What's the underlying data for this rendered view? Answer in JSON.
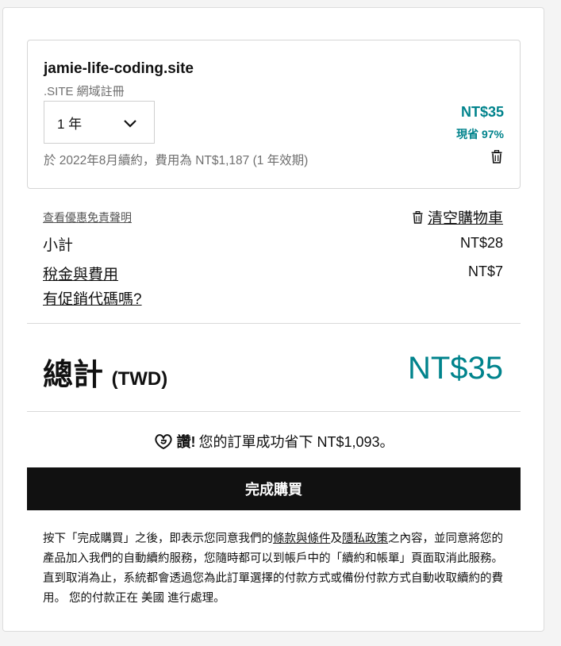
{
  "cart_item": {
    "domain": "jamie-life-coding.site",
    "tld_label": ".SITE 網域註冊",
    "term_selected": "1 年",
    "renewal_note": "於 2022年8月續約，費用為 NT$1,187 (1 年效期)",
    "price": "NT$35",
    "savings_pct": "現省 97%"
  },
  "summary": {
    "disclaimer_link": "查看優惠免責聲明",
    "clear_cart": "清空購物車",
    "subtotal_label": "小計",
    "subtotal_value": "NT$28",
    "taxes_label": "稅金與費用",
    "taxes_value": "NT$7",
    "promo_link": "有促銷代碼嗎?"
  },
  "total": {
    "label": "總計",
    "currency": "(TWD)",
    "value": "NT$35"
  },
  "savings_banner": {
    "exclaim": "讚!",
    "text": "您的訂單成功省下 NT$1,093。"
  },
  "purchase_button": "完成購買",
  "legal": {
    "part1": "按下「完成購買」之後，即表示您同意我們的",
    "terms_link": "條款與條件",
    "and": "及",
    "privacy_link": "隱私政策",
    "part2": "之內容，並同意將您的產品加入我們的自動續約服務，您隨時都可以到帳戶中的「續約和帳單」頁面取消此服務。直到取消為止，系統都會透過您為此訂單選擇的付款方式或備份付款方式自動收取續約的費用。 您的付款正在 美國 進行處理。"
  },
  "colors": {
    "accent": "#00838c",
    "button": "#111111"
  },
  "icons": [
    "chevron-down-icon",
    "trash-icon",
    "godaddy-logo-icon"
  ]
}
